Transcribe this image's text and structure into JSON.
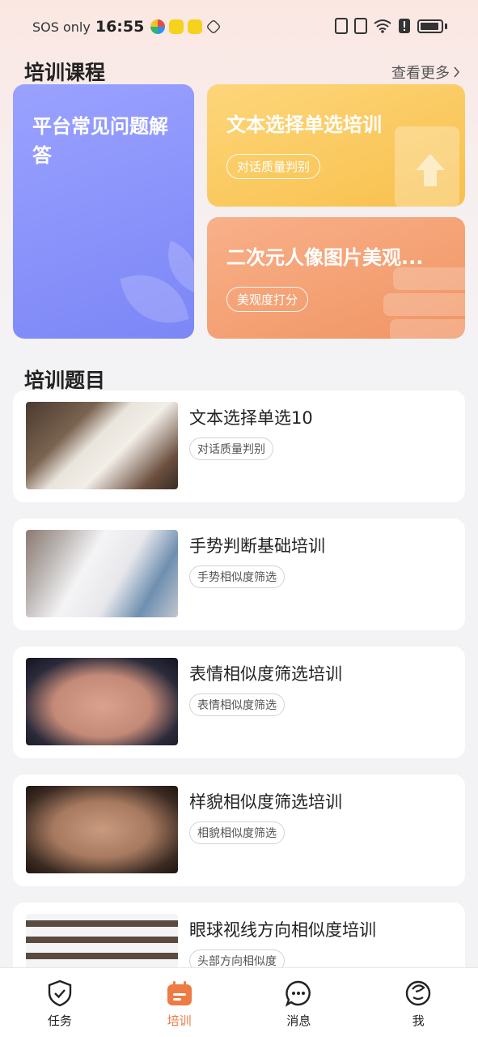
{
  "status_bar": {
    "carrier": "SOS only",
    "time": "16:55"
  },
  "courses": {
    "title": "培训课程",
    "more_label": "查看更多",
    "cards": [
      {
        "title": "平台常见问题解答"
      },
      {
        "title": "文本选择单选培训",
        "tag": "对话质量判别"
      },
      {
        "title": "二次元人像图片美观...",
        "tag": "美观度打分"
      }
    ]
  },
  "topics": {
    "title": "培训题目",
    "items": [
      {
        "title": "文本选择单选10",
        "tag": "对话质量判别"
      },
      {
        "title": "手势判断基础培训",
        "tag": "手势相似度筛选"
      },
      {
        "title": "表情相似度筛选培训",
        "tag": "表情相似度筛选"
      },
      {
        "title": "样貌相似度筛选培训",
        "tag": "相貌相似度筛选"
      },
      {
        "title": "眼球视线方向相似度培训",
        "tag": "头部方向相似度"
      }
    ]
  },
  "tabbar": {
    "tabs": [
      {
        "label": "任务",
        "icon": "shield-check-icon"
      },
      {
        "label": "培训",
        "icon": "calendar-icon"
      },
      {
        "label": "消息",
        "icon": "chat-bubble-icon"
      },
      {
        "label": "我",
        "icon": "profile-icon"
      }
    ],
    "active_color": "#ee7a44"
  }
}
